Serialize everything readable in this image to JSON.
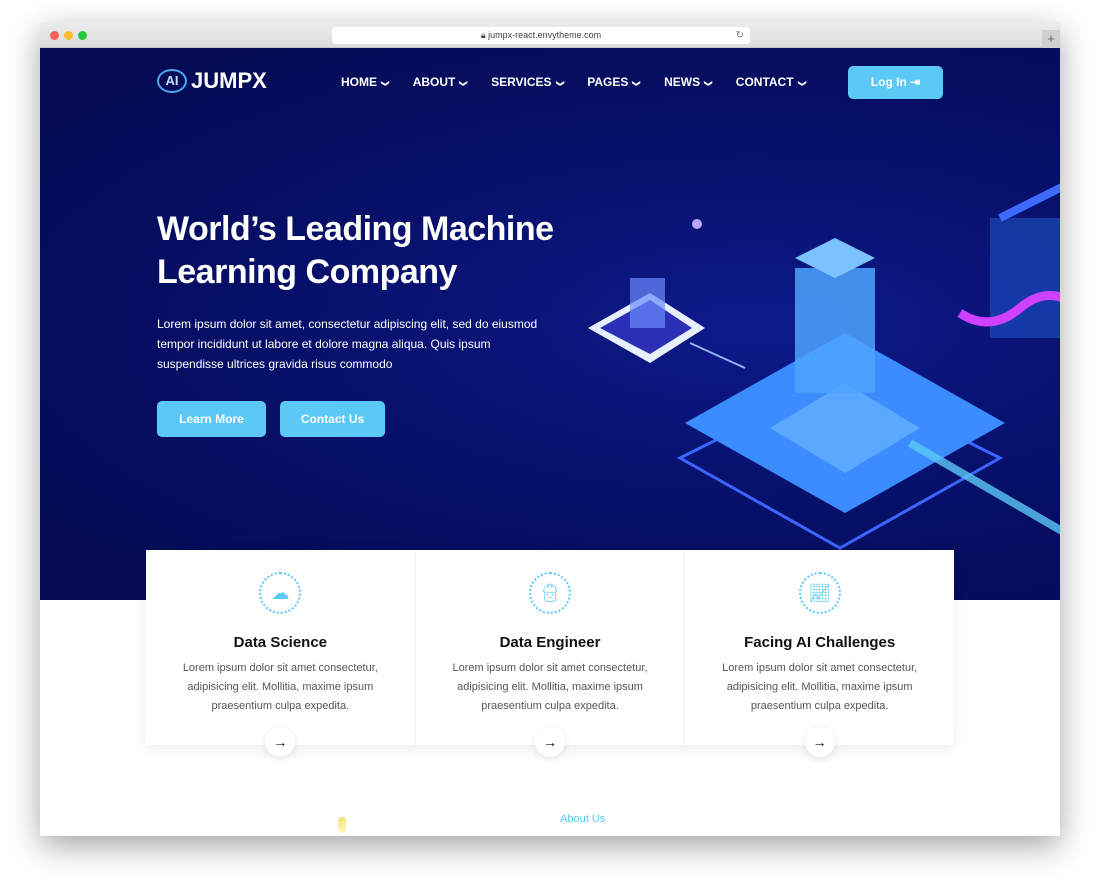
{
  "browser": {
    "url": "jumpx-react.envytheme.com"
  },
  "header": {
    "logo_mark": "AI",
    "logo_text": "JUMPX",
    "nav": [
      {
        "label": "HOME"
      },
      {
        "label": "ABOUT"
      },
      {
        "label": "SERVICES"
      },
      {
        "label": "PAGES"
      },
      {
        "label": "NEWS"
      },
      {
        "label": "CONTACT"
      }
    ],
    "login_label": "Log In ⇥"
  },
  "hero": {
    "title": "World’s Leading Machine Learning Company",
    "description": "Lorem ipsum dolor sit amet, consectetur adipiscing elit, sed do eiusmod tempor incididunt ut labore et dolore magna aliqua. Quis ipsum suspendisse ultrices gravida risus commodo",
    "learn_more": "Learn More",
    "contact_us": "Contact Us"
  },
  "cards": [
    {
      "icon": "cloud-icon",
      "title": "Data Science",
      "text": "Lorem ipsum dolor sit amet consectetur, adipisicing elit. Mollitia, maxime ipsum praesentium culpa expedita."
    },
    {
      "icon": "engineer-icon",
      "title": "Data Engineer",
      "text": "Lorem ipsum dolor sit amet consectetur, adipisicing elit. Mollitia, maxime ipsum praesentium culpa expedita."
    },
    {
      "icon": "chart-growth-icon",
      "title": "Facing AI Challenges",
      "text": "Lorem ipsum dolor sit amet consectetur, adipisicing elit. Mollitia, maxime ipsum praesentium culpa expedita."
    }
  ],
  "about": {
    "label": "About Us"
  },
  "colors": {
    "accent": "#5bc8f5",
    "hero_bg": "#060d5e"
  }
}
